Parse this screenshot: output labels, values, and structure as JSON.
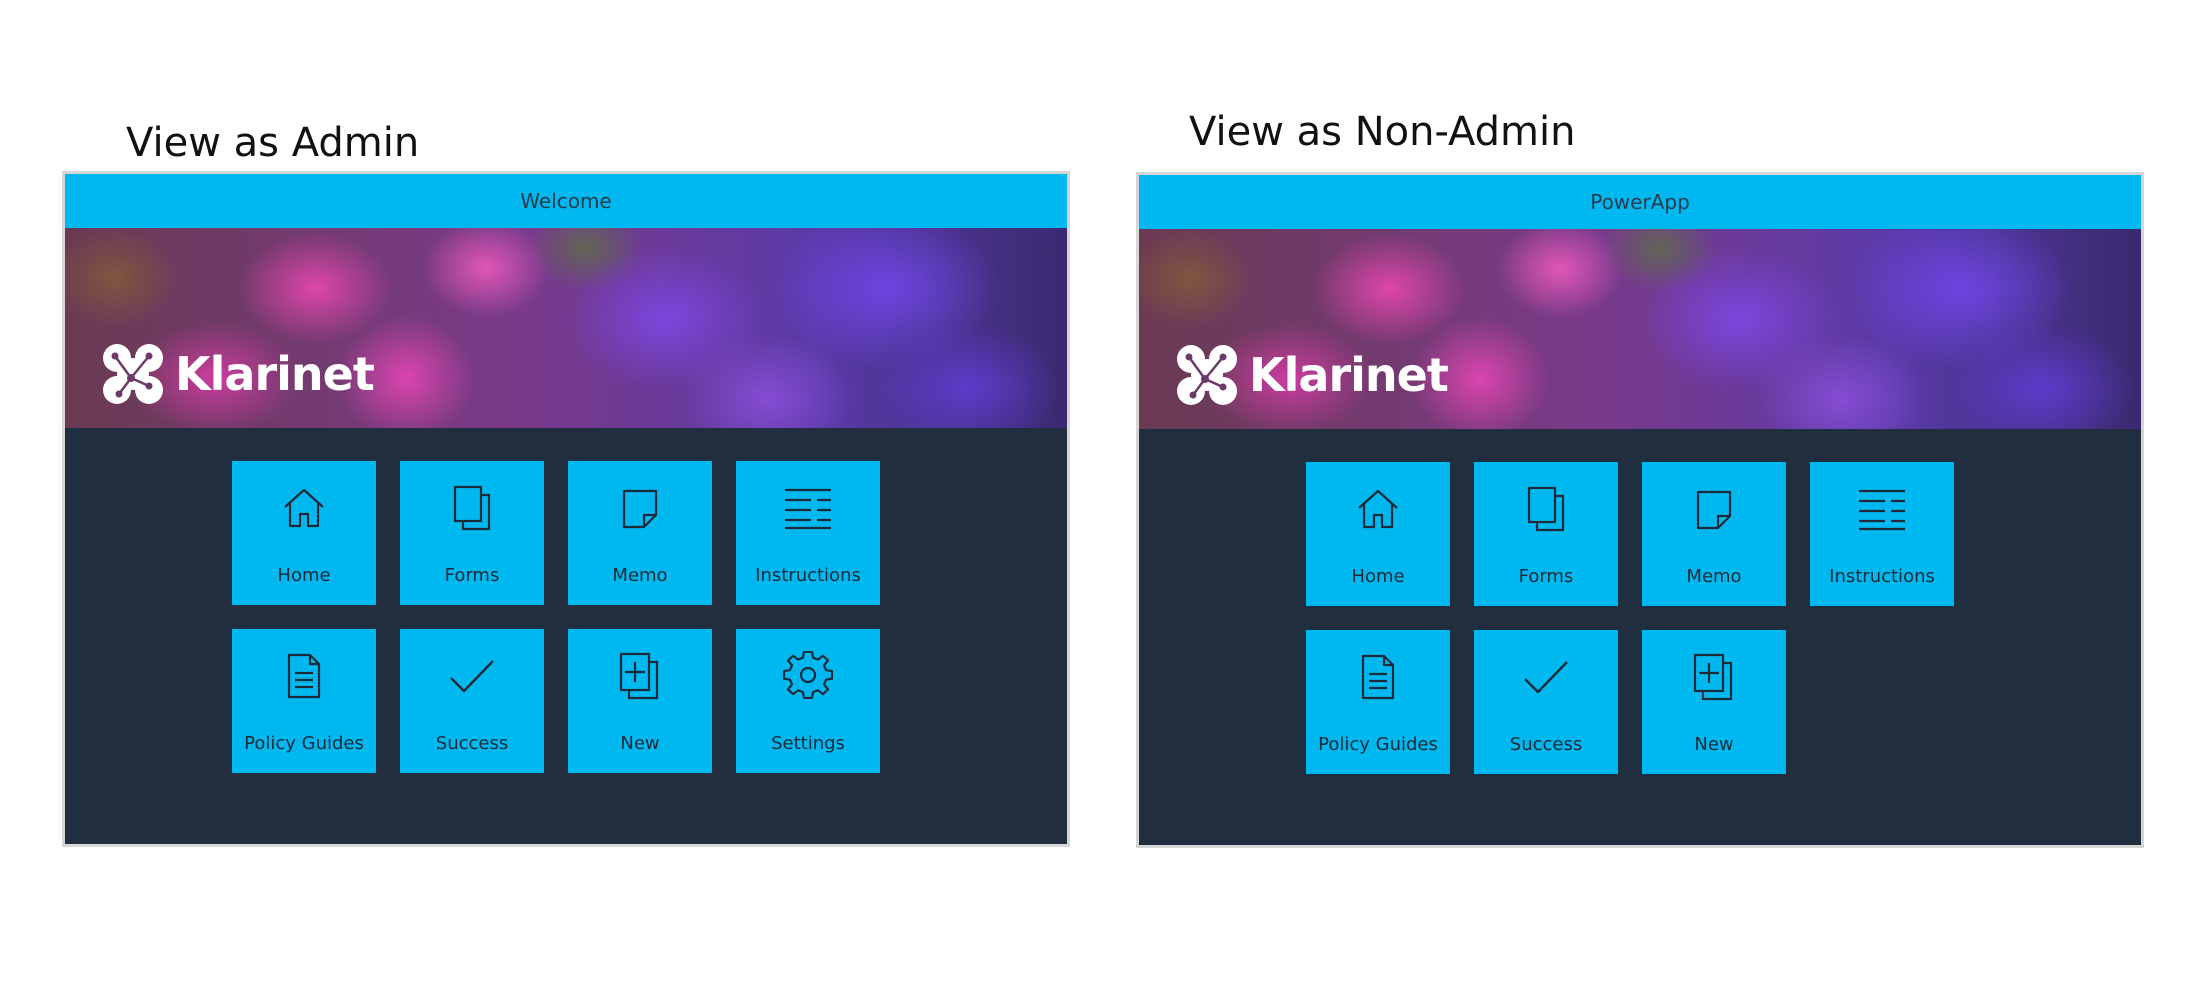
{
  "admin_view": {
    "label": "View as Admin",
    "header_title": "Welcome",
    "brand_name": "Klarinet",
    "tiles": [
      {
        "label": "Home",
        "icon": "home-icon"
      },
      {
        "label": "Forms",
        "icon": "forms-icon"
      },
      {
        "label": "Memo",
        "icon": "memo-icon"
      },
      {
        "label": "Instructions",
        "icon": "instructions-icon"
      },
      {
        "label": "Policy Guides",
        "icon": "document-icon"
      },
      {
        "label": "Success",
        "icon": "checkmark-icon"
      },
      {
        "label": "New",
        "icon": "new-icon"
      },
      {
        "label": "Settings",
        "icon": "gear-icon"
      }
    ]
  },
  "nonadmin_view": {
    "label": "View as Non-Admin",
    "header_title": "PowerApp",
    "brand_name": "Klarinet",
    "tiles": [
      {
        "label": "Home",
        "icon": "home-icon"
      },
      {
        "label": "Forms",
        "icon": "forms-icon"
      },
      {
        "label": "Memo",
        "icon": "memo-icon"
      },
      {
        "label": "Instructions",
        "icon": "instructions-icon"
      },
      {
        "label": "Policy Guides",
        "icon": "document-icon"
      },
      {
        "label": "Success",
        "icon": "checkmark-icon"
      },
      {
        "label": "New",
        "icon": "new-icon"
      }
    ]
  },
  "colors": {
    "header": "#00b8f0",
    "tile": "#00b8f0",
    "app_background": "#202e3f",
    "icon_stroke": "#1e2a38"
  }
}
